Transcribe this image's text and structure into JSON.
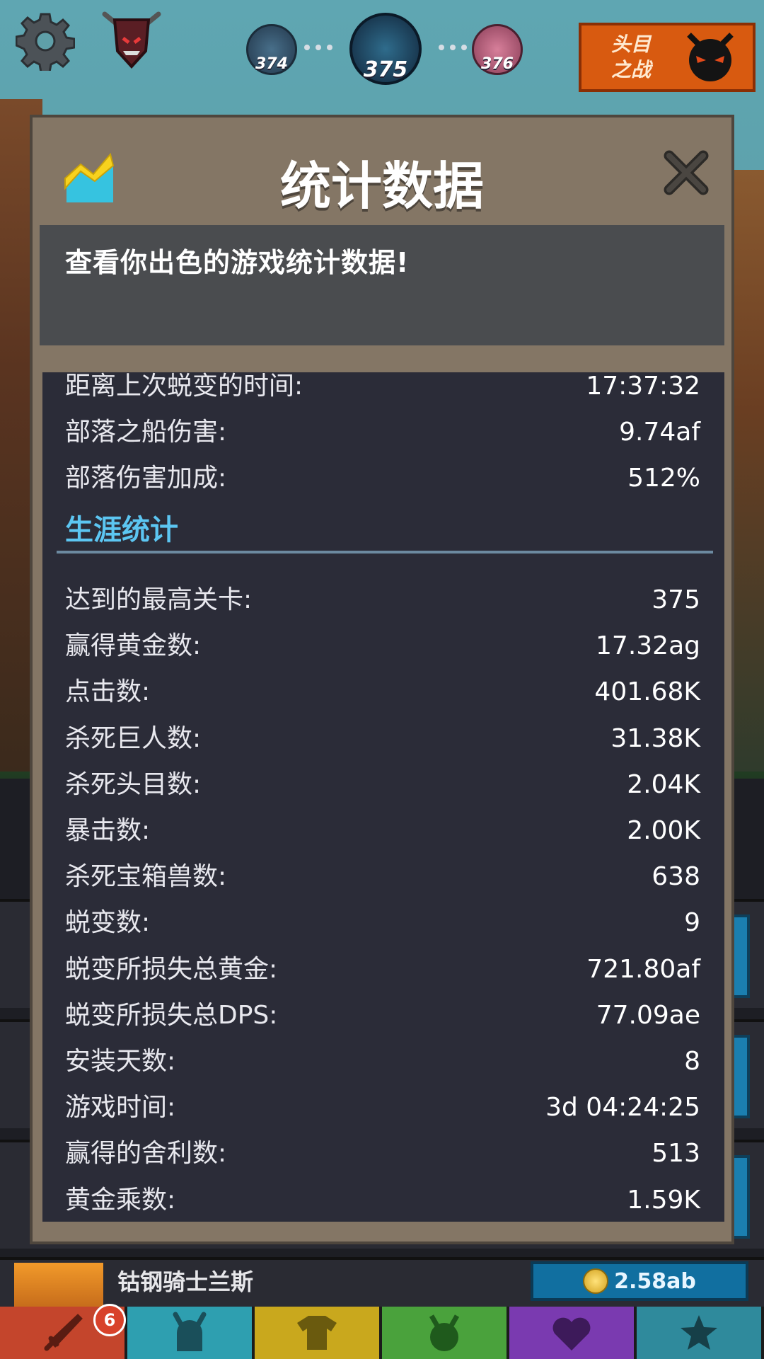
{
  "hud": {
    "stages": {
      "previous": "374",
      "current": "375",
      "next": "376"
    },
    "boss_button_label": "头目\n之战"
  },
  "modal": {
    "title": "统计数据",
    "description": "查看你出色的游戏统计数据!",
    "icons": {
      "title_icon": "chart-icon",
      "close": "close-icon"
    },
    "stats_top": [
      {
        "label": "距离上次蜕变的时间:",
        "value": "17:37:32"
      },
      {
        "label": "部落之船伤害:",
        "value": "9.74af"
      },
      {
        "label": "部落伤害加成:",
        "value": "512%"
      }
    ],
    "career_section_title": "生涯统计",
    "career_stats": [
      {
        "label": "达到的最高关卡:",
        "value": "375"
      },
      {
        "label": "赢得黄金数:",
        "value": "17.32ag"
      },
      {
        "label": "点击数:",
        "value": "401.68K"
      },
      {
        "label": "杀死巨人数:",
        "value": "31.38K"
      },
      {
        "label": "杀死头目数:",
        "value": "2.04K"
      },
      {
        "label": "暴击数:",
        "value": "2.00K"
      },
      {
        "label": "杀死宝箱兽数:",
        "value": "638"
      },
      {
        "label": "蜕变数:",
        "value": "9"
      },
      {
        "label": "蜕变所损失总黄金:",
        "value": "721.80af"
      },
      {
        "label": "蜕变所损失总DPS:",
        "value": "77.09ae"
      },
      {
        "label": "安装天数:",
        "value": "8"
      },
      {
        "label": "游戏时间:",
        "value": "3d 04:24:25"
      },
      {
        "label": "赢得的舍利数:",
        "value": "513"
      },
      {
        "label": "黄金乘数:",
        "value": "1.59K"
      }
    ]
  },
  "bottom": {
    "hero_name": "钴钢骑士兰斯",
    "hero_cost": "2.58ab",
    "tabs": [
      {
        "icon": "sword-icon",
        "color": "#c4452c",
        "badge": "6"
      },
      {
        "icon": "viking-helmet-icon",
        "color": "#2e9fb0"
      },
      {
        "icon": "shirt-icon",
        "color": "#c9a81d"
      },
      {
        "icon": "pet-icon",
        "color": "#4aa23c"
      },
      {
        "icon": "heart-icon",
        "color": "#7a3ab0"
      },
      {
        "icon": "star-icon",
        "color": "#2f8a9c"
      }
    ]
  }
}
